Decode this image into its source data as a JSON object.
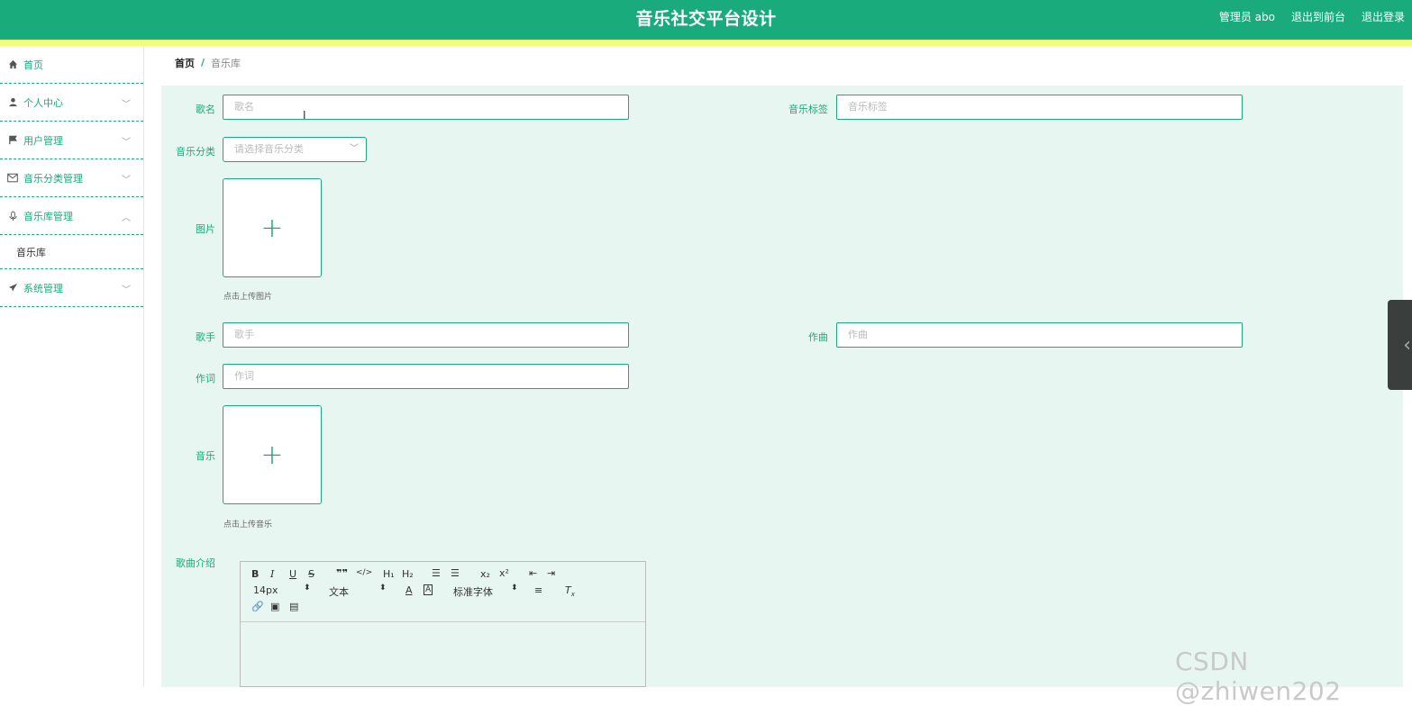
{
  "header": {
    "title": "音乐社交平台设计",
    "admin": "管理员 abo",
    "front": "退出到前台",
    "logout": "退出登录"
  },
  "sidebar": {
    "items": [
      {
        "label": "首页",
        "icon": "home-icon"
      },
      {
        "label": "个人中心",
        "icon": "person-icon"
      },
      {
        "label": "用户管理",
        "icon": "flag-icon"
      },
      {
        "label": "音乐分类管理",
        "icon": "mail-icon"
      },
      {
        "label": "音乐库管理",
        "icon": "mic-icon"
      },
      {
        "label": "系统管理",
        "icon": "send-icon"
      }
    ],
    "sub": {
      "label": "音乐库"
    }
  },
  "breadcrumb": {
    "home": "首页",
    "sep": "/",
    "current": "音乐库"
  },
  "form": {
    "name_label": "歌名",
    "name_placeholder": "歌名",
    "tag_label": "音乐标签",
    "tag_placeholder": "音乐标签",
    "category_label": "音乐分类",
    "category_placeholder": "请选择音乐分类",
    "image_label": "图片",
    "image_hint": "点击上传图片",
    "singer_label": "歌手",
    "singer_placeholder": "歌手",
    "composer_label": "作曲",
    "composer_placeholder": "作曲",
    "lyricist_label": "作词",
    "lyricist_placeholder": "作词",
    "music_label": "音乐",
    "music_hint": "点击上传音乐",
    "intro_label": "歌曲介绍"
  },
  "editor": {
    "font_size": "14px",
    "text_style": "文本",
    "font_family": "标准字体"
  },
  "watermark": "CSDN @zhiwen202",
  "colors": {
    "accent": "#1aab7c",
    "strip": "#f2ff7d",
    "form_bg": "#e8f6f2"
  }
}
